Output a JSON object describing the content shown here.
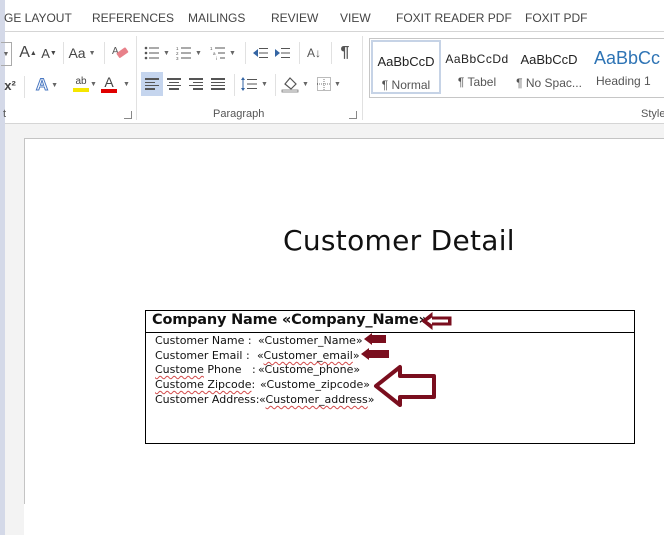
{
  "tabs": [
    "GE LAYOUT",
    "REFERENCES",
    "MAILINGS",
    "REVIEW",
    "VIEW",
    "FOXIT READER PDF",
    "FOXIT PDF"
  ],
  "ribbon": {
    "font_group_label_fragment": "t",
    "paragraph_label": "Paragraph",
    "styles_label": "Style",
    "font_buttons": {
      "grow_font": "A",
      "shrink_font": "A",
      "change_case": "Aa",
      "superscript": "x²",
      "text_effects": "A",
      "highlight": "ab",
      "font_color": "A"
    },
    "highlight_color": "#f5e600",
    "font_color_bar": "#e00000",
    "pilcrow": "¶",
    "sort": "A↓",
    "styles": [
      {
        "sample": "AaBbCcD",
        "name": "¶ Normal",
        "active": true
      },
      {
        "sample": "AaBbCcDd",
        "name": "¶ Tabel",
        "active": false
      },
      {
        "sample": "AaBbCcD",
        "name": "¶ No Spac...",
        "active": false
      },
      {
        "sample": "AaBbCc",
        "name": "Heading 1",
        "active": false
      }
    ],
    "heading_color": "#2e74b5"
  },
  "document": {
    "title": "Customer Detail",
    "company_line": "Company Name «Company_Name»:",
    "fields": [
      {
        "label": "Customer Name  :",
        "value": "«Customer_Name»",
        "label_misspelled": false,
        "value_misspelled": false
      },
      {
        "label": "Customer Email  :",
        "value": "«Customer_email»",
        "label_misspelled": false,
        "value_misspelled": true
      },
      {
        "label": "Custome Phone   :",
        "value": "«Custome_phone»",
        "label_misspelled": true,
        "value_misspelled": false
      },
      {
        "label": "Custome Zipcode:",
        "value": "«Custome_zipcode»",
        "label_misspelled": true,
        "value_misspelled": false
      },
      {
        "label": "Customer Address:",
        "value": "«Customer_address»",
        "label_misspelled": false,
        "value_misspelled": true
      }
    ],
    "arrow_color": "#7a0e1e"
  }
}
